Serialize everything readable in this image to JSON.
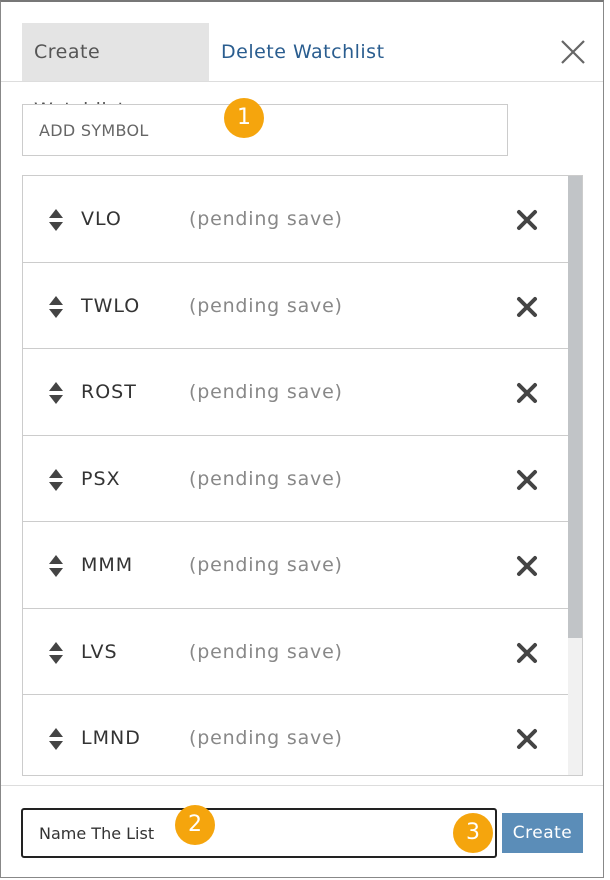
{
  "tabs": {
    "create_label": "Create Watchlist",
    "delete_label": "Delete Watchlist"
  },
  "symbol_input": {
    "placeholder": "ADD SYMBOL"
  },
  "badges": {
    "one": "1",
    "two": "2",
    "three": "3"
  },
  "symbols": [
    {
      "ticker": "VLO",
      "status": "(pending save)"
    },
    {
      "ticker": "TWLO",
      "status": "(pending save)"
    },
    {
      "ticker": "ROST",
      "status": "(pending save)"
    },
    {
      "ticker": "PSX",
      "status": "(pending save)"
    },
    {
      "ticker": "MMM",
      "status": "(pending save)"
    },
    {
      "ticker": "LVS",
      "status": "(pending save)"
    },
    {
      "ticker": "LMND",
      "status": "(pending save)"
    }
  ],
  "name_input": {
    "value": "Name The List"
  },
  "create_button": {
    "label": "Create"
  },
  "icons": {
    "close": "close-icon",
    "sort": "sort-arrows-icon",
    "remove": "remove-x-icon"
  },
  "colors": {
    "accent": "#2a5d8f",
    "button": "#5b8db8",
    "badge": "#f5a50d",
    "tab_active_bg": "#e4e4e4"
  }
}
